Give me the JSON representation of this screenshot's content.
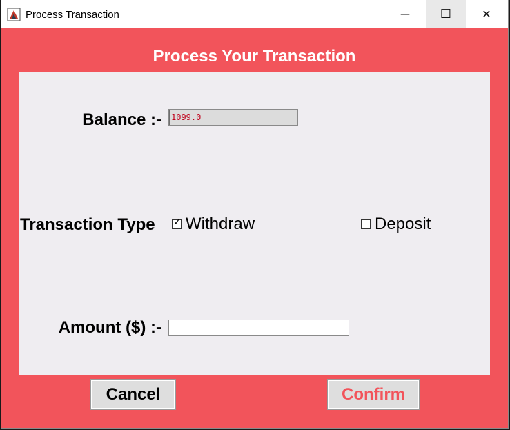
{
  "window": {
    "title": "Process Transaction",
    "icons": {
      "app": "java-app-icon",
      "minimize": "minimize-icon",
      "maximize": "maximize-icon",
      "close": "close-icon"
    },
    "glyphs": {
      "minimize": "—",
      "maximize": "☐",
      "close": "✕"
    }
  },
  "header": {
    "title": "Process Your Transaction"
  },
  "form": {
    "balance_label": "Balance :-",
    "balance_value": "1099.0",
    "type_label": "Transaction Type",
    "withdraw": {
      "label": "Withdraw",
      "checked": true
    },
    "deposit": {
      "label": "Deposit",
      "checked": false
    },
    "amount_label": "Amount ($) :-",
    "amount_value": ""
  },
  "buttons": {
    "cancel": "Cancel",
    "confirm": "Confirm"
  },
  "colors": {
    "background": "#f2545b",
    "panel": "#efedf1",
    "confirm_text": "#f2545b",
    "balance_text": "#c0001a"
  }
}
